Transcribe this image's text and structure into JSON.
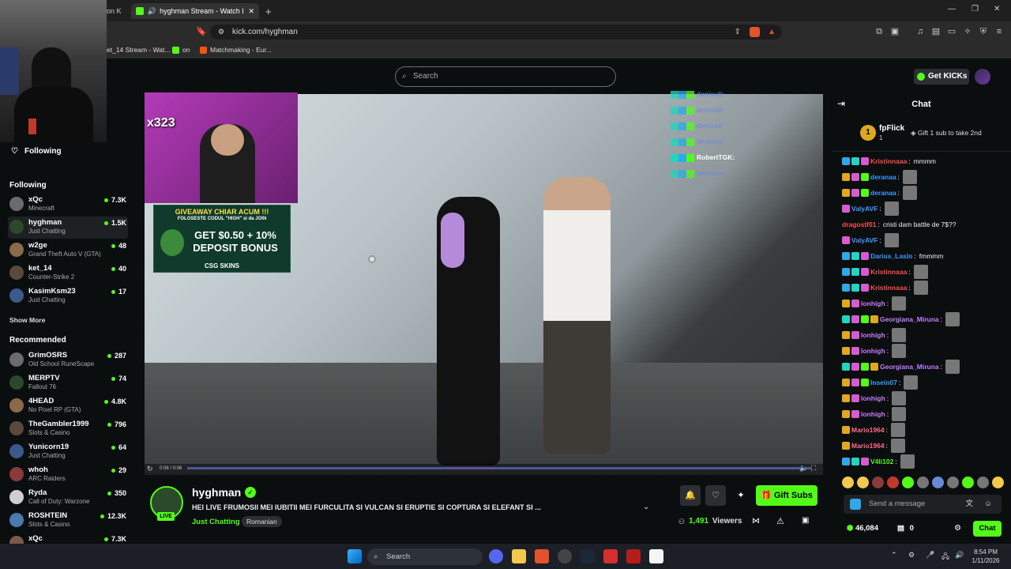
{
  "browser": {
    "tabs": [
      {
        "label": "on K"
      },
      {
        "label": "hyghman Stream - Watch Liv",
        "active": true
      }
    ],
    "new_tab": "+",
    "url": "kick.com/hyghman",
    "bookmarks": [
      "et_14 Stream - Wat...",
      "on",
      "Matchmaking - Eur..."
    ]
  },
  "header": {
    "search_placeholder": "Search",
    "get_kicks": "Get KICKs"
  },
  "sidebar": {
    "following_title": "Following",
    "following_section": "Following",
    "following": [
      {
        "name": "xQc",
        "category": "Minecraft",
        "viewers": "7.3K"
      },
      {
        "name": "hyghman",
        "category": "Just Chatting",
        "viewers": "1.5K"
      },
      {
        "name": "w2ge",
        "category": "Grand Theft Auto V (GTA)",
        "viewers": "48"
      },
      {
        "name": "ket_14",
        "category": "Counter-Strike 2",
        "viewers": "40"
      },
      {
        "name": "KasimKsm23",
        "category": "Just Chatting",
        "viewers": "17"
      }
    ],
    "show_more": "Show More",
    "recommended_section": "Recommended",
    "recommended": [
      {
        "name": "GrimOSRS",
        "category": "Old School RuneScape",
        "viewers": "287"
      },
      {
        "name": "MERPTV",
        "category": "Fallout 76",
        "viewers": "74"
      },
      {
        "name": "4HEAD",
        "category": "No Pixel RP (GTA)",
        "viewers": "4.8K"
      },
      {
        "name": "TheGambler1999",
        "category": "Slots & Casino",
        "viewers": "796"
      },
      {
        "name": "Yunicorn19",
        "category": "Just Chatting",
        "viewers": "64"
      },
      {
        "name": "whoh",
        "category": "ARC Raiders",
        "viewers": "29"
      },
      {
        "name": "Ryda",
        "category": "Call of Duty: Warzone",
        "viewers": "350"
      },
      {
        "name": "ROSHTEIN",
        "category": "Slots & Casino",
        "viewers": "12.3K"
      },
      {
        "name": "xQc",
        "category": "",
        "viewers": "7.3K"
      }
    ]
  },
  "video": {
    "overlay_count": "x323",
    "ad": {
      "line1": "GIVEAWAY CHIAR ACUM !!!",
      "line2": "FOLOSESTE CODUL \"HIGH\" si da JOIN",
      "line3": "GET $0.50 + 10%",
      "line4": "DEPOSIT BONUS",
      "line5": "CSG SKINS"
    },
    "overlay_names": [
      "denisull:",
      "denisull:",
      "denisull:",
      "denisull:",
      "RobertTGK:",
      "deranaa:"
    ],
    "time": "0:06 / 0:06",
    "progress": 0.998
  },
  "stream": {
    "channel": "hyghman",
    "live": "LIVE",
    "title": "HEI LIVE FRUMOSII MEI IUBITII MEI FURCULITA SI VULCAN SI ERUPTIE SI COPTURA SI ELEFANT SI ...",
    "category": "Just Chatting",
    "language": "Romanian",
    "gift_subs": "Gift Subs",
    "viewers": "1,491",
    "viewers_label": "Viewers"
  },
  "chat": {
    "title": "Chat",
    "pinned_user": "fpFlick",
    "pinned_count": "1",
    "pinned_text": "Gift 1 sub to take 2nd",
    "messages": [
      {
        "user": "Kristinnaaa",
        "color": "#ff4b4b",
        "text": "mmmm",
        "badges": [
          "blue",
          "teal",
          "pink"
        ]
      },
      {
        "user": "deranaa",
        "color": "#3b9bff",
        "text": "",
        "badges": [
          "gold",
          "pink",
          "green"
        ],
        "emote": true
      },
      {
        "user": "deranaa",
        "color": "#3b9bff",
        "text": "",
        "badges": [
          "gold",
          "pink",
          "green"
        ],
        "emote": true
      },
      {
        "user": "ValyAVF",
        "color": "#3b9bff",
        "text": "",
        "badges": [
          "pink"
        ],
        "emote": true
      },
      {
        "user": "dragostf01",
        "color": "#ff4b4b",
        "text": "cristi dam battle de 7$??",
        "badges": []
      },
      {
        "user": "ValyAVF",
        "color": "#3b9bff",
        "text": "",
        "badges": [
          "pink"
        ],
        "emote": true
      },
      {
        "user": "Darius_Laslo",
        "color": "#3b9bff",
        "text": "fmmmm",
        "badges": [
          "blue",
          "teal",
          "pink"
        ]
      },
      {
        "user": "Kristinnaaa",
        "color": "#ff4b4b",
        "text": "",
        "badges": [
          "blue",
          "teal",
          "pink"
        ],
        "emote": true
      },
      {
        "user": "Kristinnaaa",
        "color": "#ff4b4b",
        "text": "",
        "badges": [
          "blue",
          "teal",
          "pink"
        ],
        "emote": true
      },
      {
        "user": "lonhigh",
        "color": "#c77dff",
        "text": "",
        "badges": [
          "gold",
          "pink"
        ],
        "emote": true
      },
      {
        "user": "Georgiana_Miruna",
        "color": "#c77dff",
        "text": "",
        "badges": [
          "teal",
          "pink",
          "green",
          "gold"
        ],
        "emote": true
      },
      {
        "user": "lonhigh",
        "color": "#c77dff",
        "text": "",
        "badges": [
          "gold",
          "pink"
        ],
        "emote": true
      },
      {
        "user": "lonhigh",
        "color": "#c77dff",
        "text": "",
        "badges": [
          "gold",
          "pink"
        ],
        "emote": true
      },
      {
        "user": "Georgiana_Miruna",
        "color": "#c77dff",
        "text": "",
        "badges": [
          "teal",
          "pink",
          "green",
          "gold"
        ],
        "emote": true
      },
      {
        "user": "Insein07",
        "color": "#3b9bff",
        "text": "",
        "badges": [
          "gold",
          "pink",
          "green"
        ],
        "emote": true
      },
      {
        "user": "lonhigh",
        "color": "#c77dff",
        "text": "",
        "badges": [
          "gold",
          "pink"
        ],
        "emote": true
      },
      {
        "user": "lonhigh",
        "color": "#c77dff",
        "text": "",
        "badges": [
          "gold",
          "pink"
        ],
        "emote": true
      },
      {
        "user": "Mario1964",
        "color": "#ff6b8b",
        "text": "",
        "badges": [
          "gold"
        ],
        "emote": true
      },
      {
        "user": "Mario1964",
        "color": "#ff6b8b",
        "text": "",
        "badges": [
          "gold"
        ],
        "emote": true
      },
      {
        "user": "V4li102",
        "color": "#53fc18",
        "text": "",
        "badges": [
          "blue",
          "teal",
          "pink"
        ],
        "emote": true
      }
    ],
    "input_placeholder": "Send a message",
    "points": "46,084",
    "redeem_count": "0",
    "send_label": "Chat"
  },
  "taskbar": {
    "search": "Search",
    "time": "8:54 PM",
    "date": "1/11/2026"
  }
}
